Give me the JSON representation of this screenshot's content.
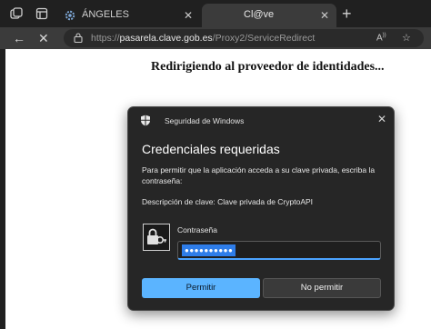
{
  "browser": {
    "tabs": [
      {
        "title": "ÁNGELES",
        "active": false
      },
      {
        "title": "Cl@ve",
        "active": true
      }
    ],
    "address": {
      "scheme": "https://",
      "host": "pasarela.clave.gob.es",
      "path": "/Proxy2/ServiceRedirect"
    }
  },
  "page": {
    "heading": "Redirigiendo al proveedor de identidades..."
  },
  "dialog": {
    "caption": "Seguridad de Windows",
    "title": "Credenciales requeridas",
    "message": "Para permitir que la aplicación acceda a su clave privada, escriba la contraseña:",
    "description": "Descripción de clave: Clave privada de CryptoAPI",
    "password_label": "Contraseña",
    "password_value": "●●●●●●●●●●",
    "allow_label": "Permitir",
    "deny_label": "No permitir"
  },
  "colors": {
    "accent": "#5bb4ff",
    "selection": "#2e7de9",
    "dialog_bg": "#262626",
    "chrome_bg": "#202020"
  }
}
